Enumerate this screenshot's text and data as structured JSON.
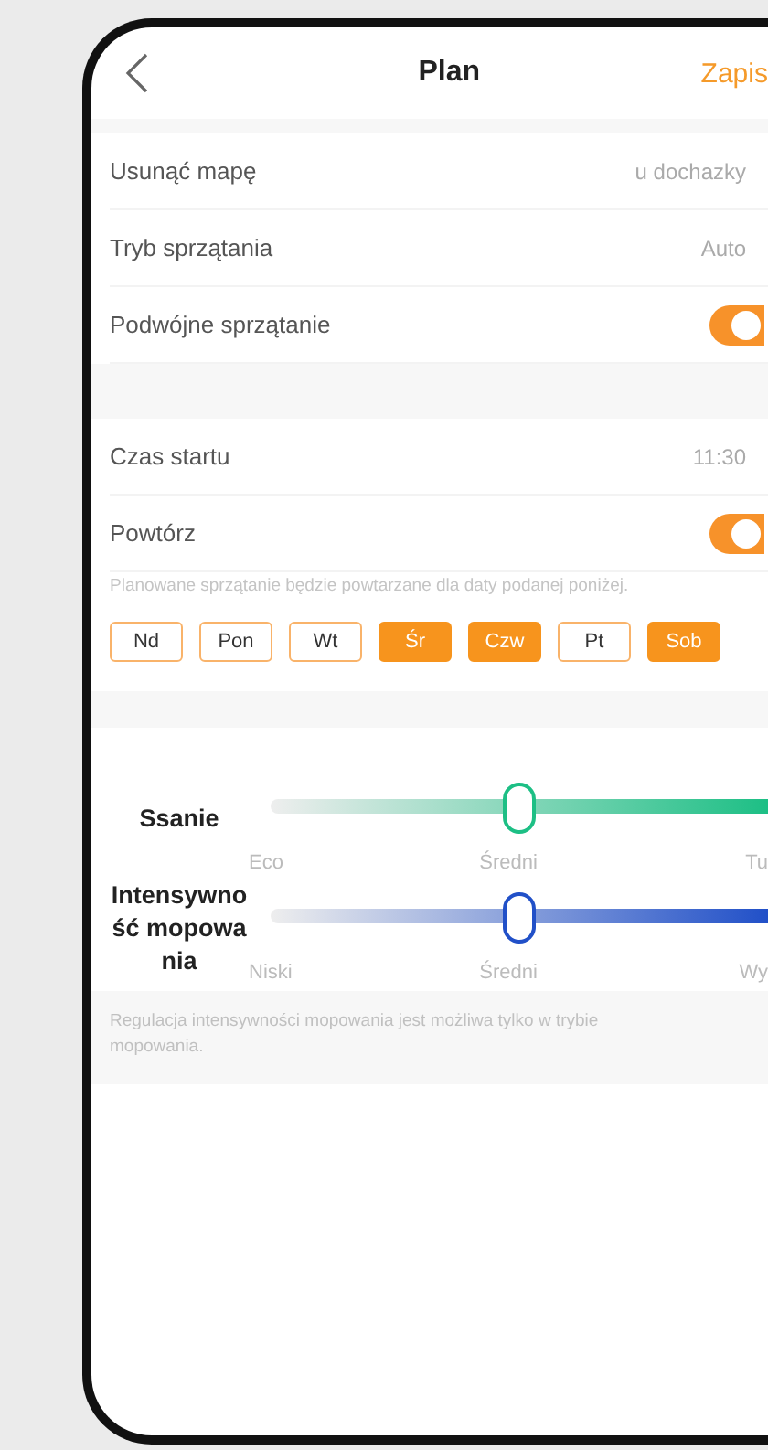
{
  "header": {
    "title": "Plan",
    "action": "Zapis"
  },
  "section_1": [
    {
      "kind": "value",
      "label": "Usunąć mapę",
      "value": "u dochazky"
    },
    {
      "kind": "value",
      "label": "Tryb sprzątania",
      "value": "Auto"
    },
    {
      "kind": "toggle",
      "label": "Podwójne sprzątanie",
      "on": true
    }
  ],
  "section_2": [
    {
      "kind": "value",
      "label": "Czas startu",
      "value": "11:30"
    },
    {
      "kind": "toggle",
      "label": "Powtórz",
      "on": true
    }
  ],
  "repeat_hint": "Planowane sprzątanie będzie powtarzane dla daty podanej poniżej.",
  "days": [
    {
      "label": "Nd",
      "selected": false
    },
    {
      "label": "Pon",
      "selected": false
    },
    {
      "label": "Wt",
      "selected": false
    },
    {
      "label": "Śr",
      "selected": true
    },
    {
      "label": "Czw",
      "selected": true
    },
    {
      "label": "Pt",
      "selected": false
    },
    {
      "label": "Sob",
      "selected": true
    }
  ],
  "sliders": [
    {
      "label": "Ssanie",
      "color": "#1dbf85",
      "level": 0.5,
      "ticks": [
        "Eco",
        "Średni",
        "Tu"
      ]
    },
    {
      "label": "Intensywność mopowania",
      "color": "#2150c8",
      "level": 0.5,
      "ticks": [
        "Niski",
        "Średni",
        "Wy"
      ]
    }
  ],
  "note": "Regulacja intensywności mopowania jest możliwa tylko w trybie mopowania."
}
